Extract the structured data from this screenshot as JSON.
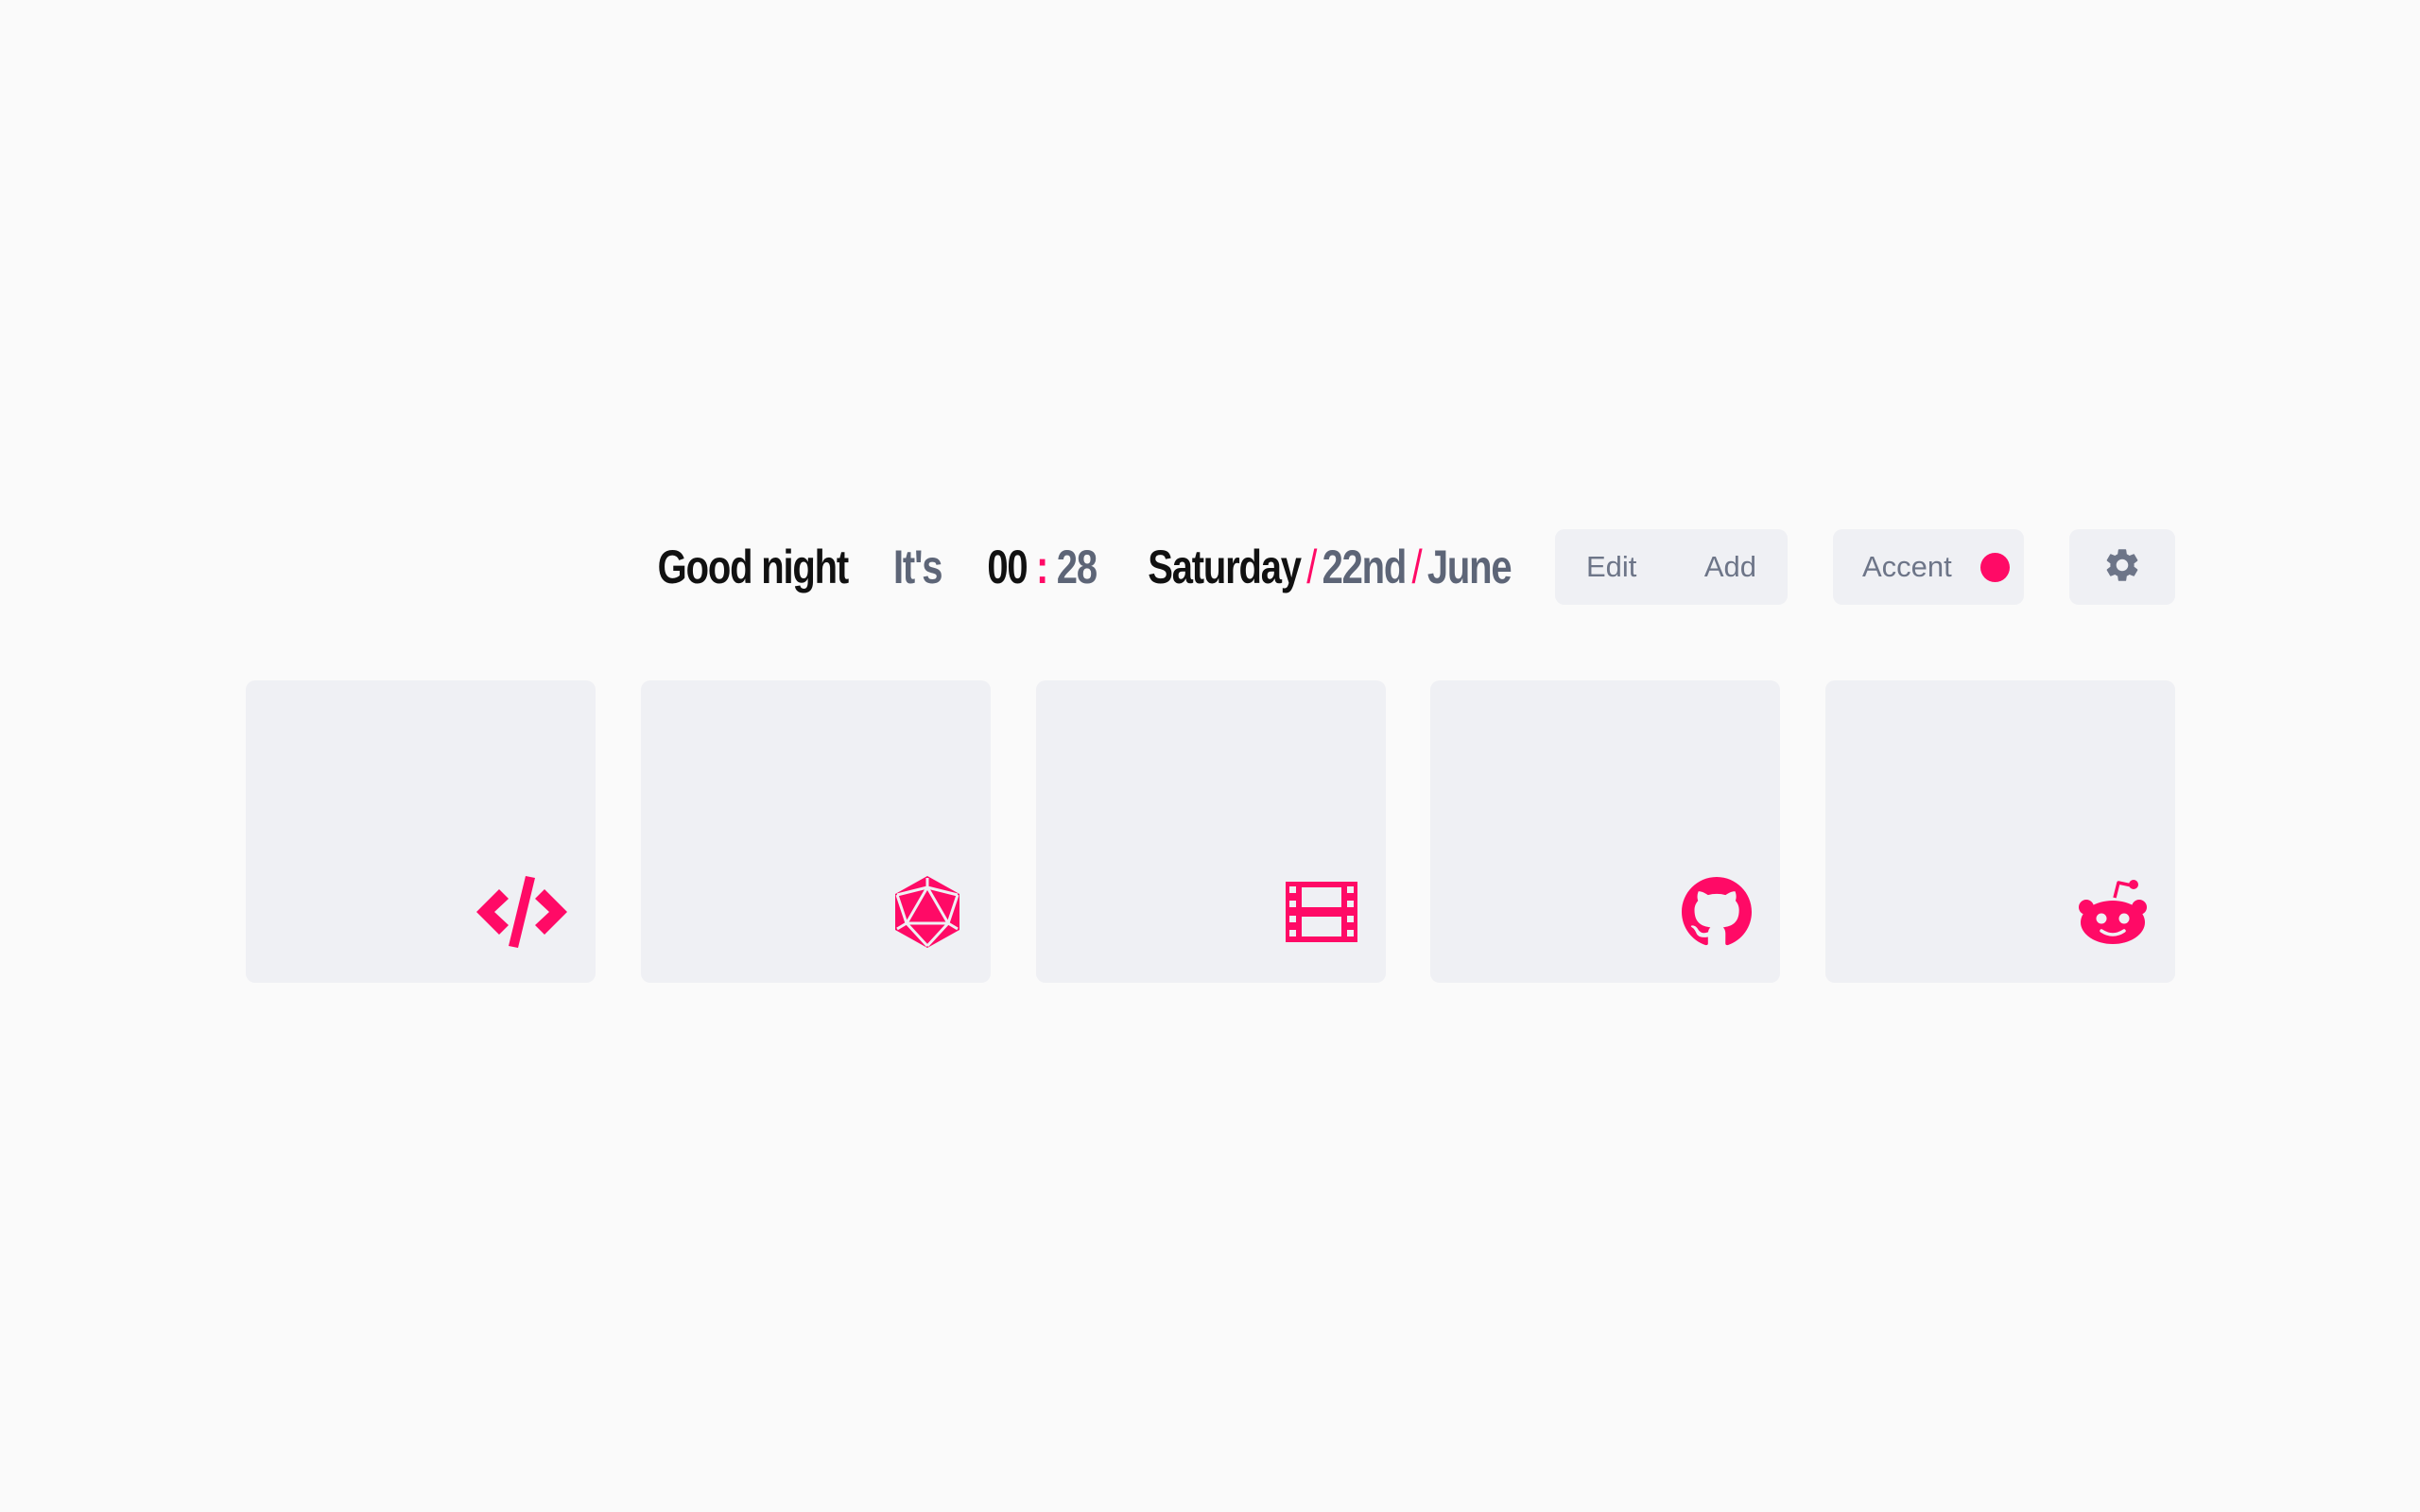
{
  "header": {
    "greeting": "Good night",
    "its": "It's",
    "hours": "00",
    "time_sep": ":",
    "minutes": "28",
    "weekday": "Saturday",
    "date_sep": "/",
    "day": "22nd",
    "month": "June"
  },
  "toolbar": {
    "edit_label": "Edit",
    "add_label": "Add",
    "accent_label": "Accent"
  },
  "settings": {
    "icon": "gear-icon"
  },
  "colors": {
    "accent": "#ff0a66",
    "background": "#fafafa",
    "card": "#eff0f4",
    "muted_text": "#5d6577"
  },
  "cards": [
    {
      "icon": "code-icon"
    },
    {
      "icon": "dice-d20-icon"
    },
    {
      "icon": "film-icon"
    },
    {
      "icon": "github-icon"
    },
    {
      "icon": "reddit-icon"
    }
  ]
}
